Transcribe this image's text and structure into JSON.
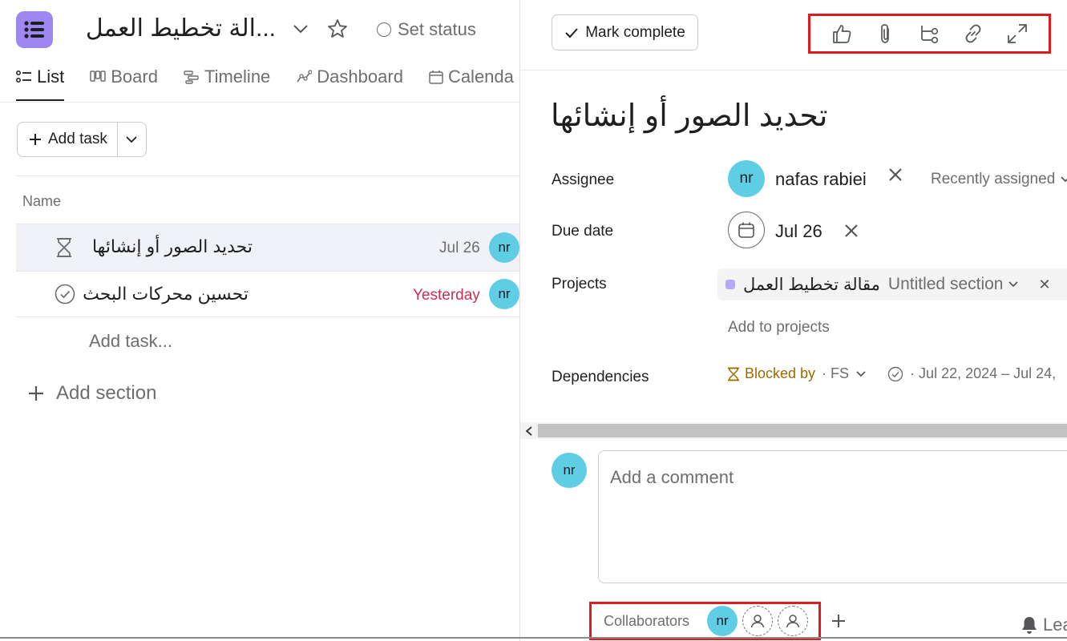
{
  "project": {
    "title": "...الة تخطيط العمل",
    "set_status_label": "Set status"
  },
  "tabs": [
    {
      "label": "List",
      "icon": "list-icon",
      "active": true
    },
    {
      "label": "Board",
      "icon": "board-icon"
    },
    {
      "label": "Timeline",
      "icon": "timeline-icon"
    },
    {
      "label": "Dashboard",
      "icon": "dashboard-icon"
    },
    {
      "label": "Calenda",
      "icon": "calendar-icon"
    }
  ],
  "list": {
    "add_task_label": "Add task",
    "column_name": "Name",
    "rows": [
      {
        "name": "تحديد الصور أو إنشائها",
        "date": "Jul 26",
        "date_status": "normal",
        "assignee_initials": "nr",
        "status_icon": "hourglass-icon",
        "selected": true
      },
      {
        "name": "تحسين محركات البحث",
        "date": "Yesterday",
        "date_status": "overdue",
        "assignee_initials": "nr",
        "status_icon": "check-circle-icon",
        "selected": false
      }
    ],
    "add_task_inline": "Add task...",
    "add_section": "Add section"
  },
  "detail": {
    "mark_complete": "Mark complete",
    "toolbar_icons": [
      "like-icon",
      "attachment-icon",
      "subtask-icon",
      "link-icon",
      "expand-icon"
    ],
    "task_title": "تحديد الصور أو إنشائها",
    "assignee": {
      "label": "Assignee",
      "initials": "nr",
      "name": "nafas rabiei",
      "recently_assigned": "Recently assigned"
    },
    "due_date": {
      "label": "Due date",
      "value": "Jul 26"
    },
    "projects": {
      "label": "Projects",
      "project_name": "مقالة تخطيط العمل",
      "section": "Untitled section",
      "add_to_projects": "Add to projects"
    },
    "dependencies": {
      "label": "Dependencies",
      "blocked_by": "Blocked by",
      "type": "· FS",
      "dates": "· Jul 22, 2024 – Jul 24,"
    },
    "comment": {
      "avatar_initials": "nr",
      "placeholder": "Add a comment"
    },
    "collaborators": {
      "label": "Collaborators",
      "avatar_initials": "nr"
    },
    "leave_label": "Lea"
  },
  "colors": {
    "accent_purple": "#9f87f2",
    "avatar_cyan": "#5fcde4",
    "overdue_red": "#c92f54",
    "blocked_amber": "#9b6a00",
    "highlight_box": "#e01b1b"
  }
}
